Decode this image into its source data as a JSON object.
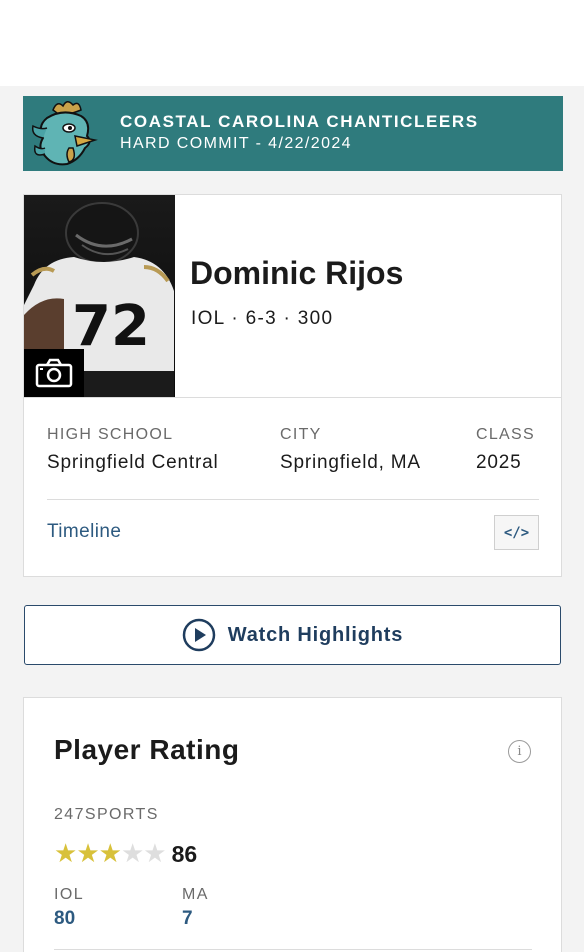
{
  "commit_banner": {
    "school": "COASTAL CAROLINA CHANTICLEERS",
    "status": "HARD COMMIT - 4/22/2024",
    "logo_icon": "chanticleer-rooster-logo",
    "color": "#2f7b7d"
  },
  "player": {
    "name": "Dominic Rijos",
    "meta": "IOL · 6-3 · 300",
    "photo_icon": "player-photo",
    "jersey_number": "72",
    "camera_icon": "camera-icon"
  },
  "details": {
    "high_school_label": "HIGH SCHOOL",
    "high_school": "Springfield Central",
    "city_label": "CITY",
    "city": "Springfield, MA",
    "class_label": "CLASS",
    "class": "2025"
  },
  "timeline": {
    "label": "Timeline",
    "embed_icon": "</>"
  },
  "highlights": {
    "label": "Watch Highlights",
    "icon": "play-circle-icon"
  },
  "rating": {
    "title": "Player Rating",
    "info_icon": "i",
    "source": "247SPORTS",
    "stars_filled": 3,
    "stars_total": 5,
    "star_glyph": "★",
    "score": "86",
    "position_label": "IOL",
    "position_rank": "80",
    "state_label": "MA",
    "state_rank": "7",
    "star_color": "#d8c13a"
  }
}
